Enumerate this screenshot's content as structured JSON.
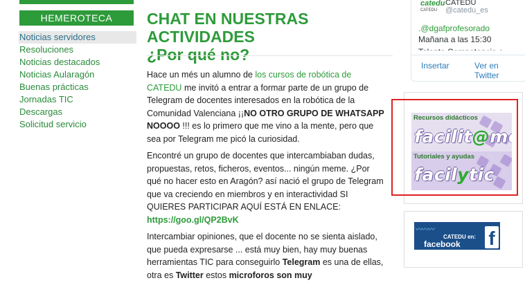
{
  "sidebar": {
    "header": "HEMEROTECA",
    "items": [
      {
        "label": "Noticias servidores",
        "active": true
      },
      {
        "label": "Resoluciones"
      },
      {
        "label": "Noticias destacados"
      },
      {
        "label": "Noticias Aularagón"
      },
      {
        "label": "Buenas prácticas"
      },
      {
        "label": "Jornadas TIC"
      },
      {
        "label": "Descargas"
      },
      {
        "label": "Solicitud servicio"
      }
    ]
  },
  "article": {
    "title_line1": "CHAT EN NUESTRAS ACTIVIDADES",
    "title_line2": "¿Por qué no?",
    "p1": {
      "t1": "Hace un més un alumno de ",
      "link": "los cursos de robótica de CATEDU",
      "t2": " me invitó a entrar a formar parte de un grupo de Telegram de docentes interesados en la robótica de la Comunidad Valenciana ¡¡",
      "bold": "NO OTRO GRUPO DE WHATSAPP NOOOO",
      "t3": " !!! es lo primero que me vino a la mente, pero que sea por Telegram me picó la curiosidad."
    },
    "p2": {
      "text": "Encontré un grupo de docentes que intercambiaban dudas, propuestas, retos, ficheros, eventos... ningún meme. ¿Por qué no hacer esto en Aragón? así nació el grupo de Telegram que va creciendo en miembros y en interactividad SI QUIERES PARTICIPAR AQUÍ ESTÁ EN ENLACE:",
      "url": "https://goo.gl/QP2BvK"
    },
    "p3": {
      "t1": "Intercambiar opiniones, que el docente no se sienta aislado, que pueda expresarse ... está muy bien, hay muy buenas herramientas TIC para conseguirlo ",
      "b1": "Telegram",
      "t2": " es una de ellas, otra es ",
      "b2": "Twitter",
      "t3": " estos ",
      "b3": "microforos son muy"
    }
  },
  "twitter": {
    "logo_text": "catedu",
    "logo_label": "CATEDU",
    "name": "CATEDU",
    "handle": "@catedu_es",
    "mention": ".@dgafprofesorado",
    "text": "Mañana a las 15:30",
    "clipped": "Talento Competencia e",
    "insert_label": "Insertar",
    "view_label": "Ver en Twitter"
  },
  "banner": {
    "top_small": "Recursos didácticos",
    "top_big_1": "facilit",
    "top_big_accent": "@",
    "top_big_2": "mos",
    "bottom_small": "Tutoriales y ayudas",
    "bottom_big_1": "facil",
    "bottom_big_accent": "y",
    "bottom_big_2": "tic"
  },
  "facebook": {
    "waves": "〰〰〰",
    "catedu_en": "CATEDU en:",
    "word": "facebook",
    "logo": "f"
  },
  "colors": {
    "brand_green": "#2e9b3a",
    "highlight_red": "#e02020",
    "facebook_blue": "#1b4f8a"
  }
}
